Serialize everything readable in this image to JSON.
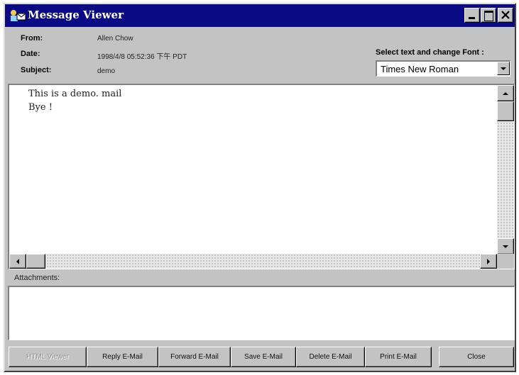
{
  "window": {
    "title": "Message Viewer",
    "icon": "message-viewer-app-icon",
    "controls": [
      "minimize-icon",
      "maximize-icon",
      "close-icon"
    ]
  },
  "header": {
    "from_label": "From:",
    "from_value": "Allen Chow",
    "date_label": "Date:",
    "date_value": "1998/4/8 05:52:36 下午 PDT",
    "subject_label": "Subject:",
    "subject_value": "demo"
  },
  "font_selector": {
    "label": "Select text and change Font :",
    "selected": "Times New Roman"
  },
  "message": {
    "lines": [
      "This is a demo. mail",
      "Bye !"
    ]
  },
  "attachments": {
    "label": "Attachments:"
  },
  "buttons": {
    "html_viewer": "HTML Viewer",
    "reply": "Reply E-Mail",
    "forward": "Forward E-Mail",
    "save": "Save E-Mail",
    "delete": "Delete E-Mail",
    "print": "Print E-Mail",
    "close": "Close"
  },
  "colors": {
    "titlebar": "#0a0a84",
    "window_face": "#c3c3c3"
  }
}
